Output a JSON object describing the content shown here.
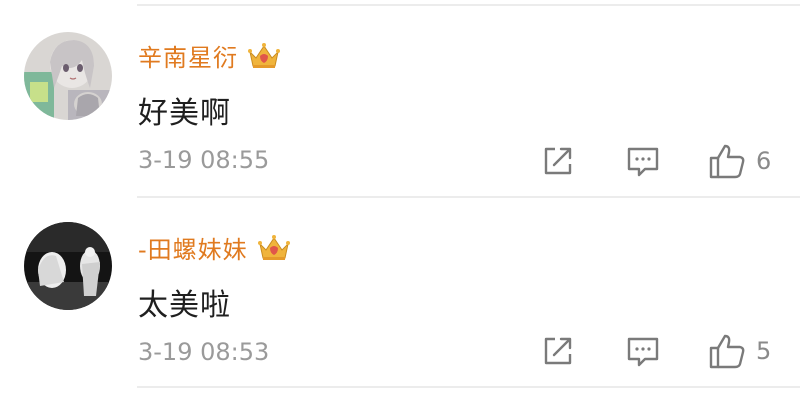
{
  "comments": [
    {
      "username": "辛南星衍",
      "text": "好美啊",
      "time": "3-19 08:55",
      "likes": "6",
      "avatar": "anime-girl-avatar",
      "badge": "crown-icon"
    },
    {
      "username": "-田螺妹妹",
      "text": "太美啦",
      "time": "3-19 08:53",
      "likes": "5",
      "avatar": "dark-photo-avatar",
      "badge": "crown-icon"
    }
  ],
  "colors": {
    "username": "#e07a1f",
    "text": "#1f1f1f",
    "meta": "#9a9a9a",
    "icon": "#7a7a7a",
    "crown_gold": "#f0b43c",
    "crown_red": "#e0564a"
  }
}
